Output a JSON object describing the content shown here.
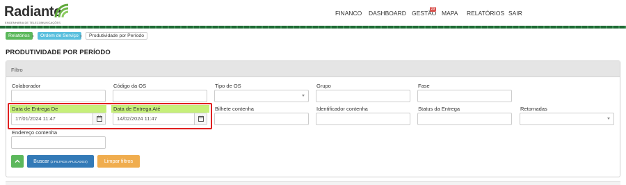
{
  "brand": {
    "name": "Radiante",
    "subtitle": "ENGENHARIA DE TELECOMUNICAÇÕES",
    "color": "#5fa83a"
  },
  "nav": {
    "items": [
      "FINANCO",
      "DASHBOARD",
      "GESTÃO",
      "MAPA",
      "RELATÓRIOS",
      "SAIR"
    ],
    "gestao_badge": "29"
  },
  "breadcrumb": {
    "items": [
      "Relatórios",
      "Ordem de Serviço",
      "Produtividade por Período"
    ]
  },
  "page": {
    "title": "PRODUTIVIDADE POR PERÍODO"
  },
  "filter": {
    "panel_title": "Filtro",
    "fields": {
      "colaborador": {
        "label": "Colaborador",
        "value": ""
      },
      "codigo_os": {
        "label": "Código da OS",
        "value": ""
      },
      "tipo_os": {
        "label": "Tipo de OS",
        "value": ""
      },
      "grupo": {
        "label": "Grupo",
        "value": ""
      },
      "fase": {
        "label": "Fase",
        "value": ""
      },
      "data_entrega_de": {
        "label": "Data de Entrega De",
        "value": "17/01/2024 11:47"
      },
      "data_entrega_ate": {
        "label": "Data de Entrega Até",
        "value": "14/02/2024 11:47"
      },
      "bilhete": {
        "label": "Bilhete contenha",
        "value": ""
      },
      "identificador": {
        "label": "Identificador contenha",
        "value": ""
      },
      "status_entrega": {
        "label": "Status da Entrega",
        "value": ""
      },
      "retornadas": {
        "label": "Retornadas",
        "value": ""
      },
      "endereco": {
        "label": "Endereço contenha",
        "value": ""
      }
    },
    "buttons": {
      "collapse_icon": "chevron-up",
      "search_label": "Buscar",
      "search_note": "(2 FILTROS APLICADOS)",
      "clear_label": "Limpar filtros"
    }
  },
  "colors": {
    "highlight_border": "#e02020",
    "highlight_label": "#c6ef7a",
    "green": "#5cb85c",
    "blue": "#337ab7",
    "orange": "#f0ad4e",
    "info": "#5bc0de"
  }
}
